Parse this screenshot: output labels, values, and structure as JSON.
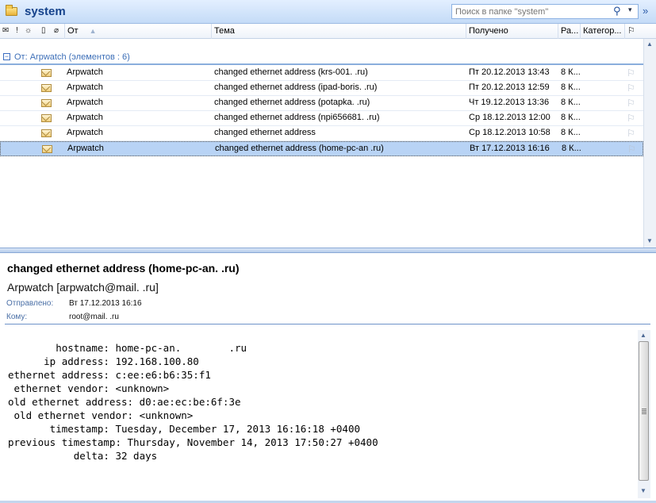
{
  "header": {
    "folder_title": "system",
    "search_placeholder": "Поиск в папке \"system\""
  },
  "columns": {
    "from": "От",
    "subject": "Тема",
    "received": "Получено",
    "size": "Ра...",
    "category": "Категор..."
  },
  "group": {
    "label": "От: Arpwatch (элементов : 6)",
    "toggle": "−"
  },
  "messages": [
    {
      "from": "Arpwatch",
      "subject": "changed ethernet address (krs-001.              .ru)",
      "received": "Пт 20.12.2013 13:43",
      "size": "8 К..."
    },
    {
      "from": "Arpwatch",
      "subject": "changed ethernet address (ipad-boris.             .ru)",
      "received": "Пт 20.12.2013 12:59",
      "size": "8 К..."
    },
    {
      "from": "Arpwatch",
      "subject": "changed ethernet address (potapka.            .ru)",
      "received": "Чт 19.12.2013 13:36",
      "size": "8 К..."
    },
    {
      "from": "Arpwatch",
      "subject": "changed ethernet address (npi656681.             .ru)",
      "received": "Ср 18.12.2013 12:00",
      "size": "8 К..."
    },
    {
      "from": "Arpwatch",
      "subject": "changed ethernet address",
      "received": "Ср 18.12.2013 10:58",
      "size": "8 К..."
    },
    {
      "from": "Arpwatch",
      "subject": "changed ethernet address (home-pc-an              .ru)",
      "received": "Вт 17.12.2013 16:16",
      "size": "8 К..."
    }
  ],
  "selected_index": 5,
  "reading": {
    "subject": "changed ethernet address (home-pc-an.               .ru)",
    "sender": "Arpwatch [arpwatch@mail.             .ru]",
    "sent_label": "Отправлено:",
    "sent_value": "Вт 17.12.2013 16:16",
    "to_label": "Кому:",
    "to_value": "root@mail.             .ru",
    "body": "        hostname: home-pc-an.        .ru\n      ip address: 192.168.100.80\nethernet address: c:ee:e6:b6:35:f1\n ethernet vendor: <unknown>\nold ethernet address: d0:ae:ec:be:6f:3e\n old ethernet vendor: <unknown>\n       timestamp: Tuesday, December 17, 2013 16:16:18 +0400\nprevious timestamp: Thursday, November 14, 2013 17:50:27 +0400\n           delta: 32 days"
  },
  "icons": {
    "folder": "folder-icon",
    "search": "⚲",
    "dropdown": "▾",
    "expand": "»",
    "flag": "⚐",
    "sort": "▲",
    "scroll_up": "▲",
    "scroll_down": "▼"
  },
  "colors": {
    "title_text": "#15428b",
    "selection": "#b8d3f5",
    "group_label": "#3d6fb8"
  }
}
